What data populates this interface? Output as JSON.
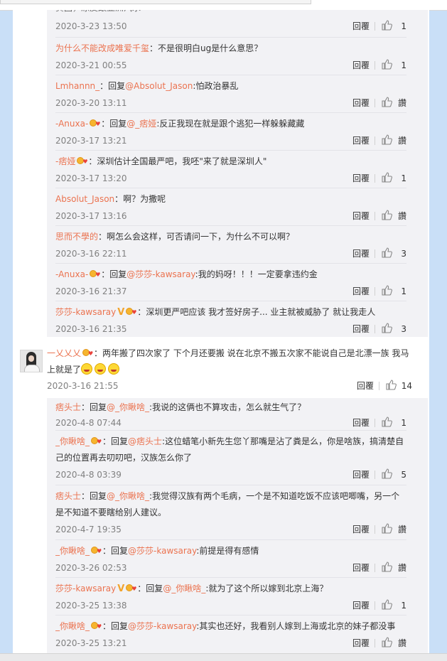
{
  "reply_label": "回覆",
  "like_icon": "thumbs-up-icon",
  "accent_color": "#eb7350",
  "thread1": [
    {
      "nick": "",
      "pre": "",
      "mention": "",
      "text": "",
      "time": "2020-3-23 13:50",
      "likes": "1",
      "clipped": "黄固，凉皮跟亚洲汽水"
    },
    {
      "nick": "为什么不能改成唯爱千玺",
      "pre": "：",
      "mention": "",
      "text": "不是很明白ug是什么意思？",
      "time": "2020-3-21 00:55",
      "likes": "1"
    },
    {
      "nick": "Lmhannn_",
      "pre": "：回复",
      "mention": "@Absolut_Jason",
      "text": ":怕政治暴乱",
      "time": "2020-3-20 13:11",
      "likes": "讚"
    },
    {
      "nick": "-Anuxa-",
      "badge": true,
      "pre": "：回复",
      "mention": "@_痞娅",
      "text": ":反正我现在就是跟个逃犯一样躲躲藏藏",
      "time": "2020-3-17 13:21",
      "likes": "讚"
    },
    {
      "nick": "-痞娅",
      "badge": true,
      "pre": "：",
      "mention": "",
      "text": "深圳估计全国最严吧，我呸\"来了就是深圳人\"",
      "time": "2020-3-17 13:20",
      "likes": "1"
    },
    {
      "nick": "Absolut_Jason",
      "pre": "：",
      "mention": "",
      "text": "啊？为撒呢",
      "time": "2020-3-17 13:16",
      "likes": "讚"
    },
    {
      "nick": "思而不學的",
      "pre": "：",
      "mention": "",
      "text": "啊怎么会这样，可否请问一下，为什么不可以啊？",
      "time": "2020-3-16 22:11",
      "likes": "3"
    },
    {
      "nick": "-Anuxa-",
      "badge": true,
      "pre": "：回复",
      "mention": "@莎莎-kawsaray",
      "text": ":我的妈呀！！！一定要拿违约金",
      "time": "2020-3-16 21:37",
      "likes": "1"
    },
    {
      "nick": "莎莎-kawsaray",
      "vip": true,
      "badge": true,
      "pre": "：",
      "mention": "",
      "text": "深圳更严吧应该 我才签好房子... 业主就被威胁了 就让我走人",
      "time": "2020-3-16 21:35",
      "likes": "3"
    }
  ],
  "main": {
    "nick": "一乂乂乂",
    "text": "：两年搬了四次家了 下个月还要搬 说在北京不搬五次家不能说自己是北漂一族 我马上就是了",
    "time": "2020-3-16 21:55",
    "likes": "14"
  },
  "thread2": [
    {
      "nick": "痞头士",
      "pre": "：回复",
      "mention": "@_你瞅啥_",
      "text": ":我说的这俩也不算攻击，怎么就生气了？",
      "time": "2020-4-8 07:44",
      "likes": "1"
    },
    {
      "nick": "_你瞅啥_",
      "badge": true,
      "pre": "：回复",
      "mention": "@痞头士",
      "text": ":这位蜡笔小新先生您丫那嘴是沾了粪是么，你是啥族，搞清楚自己的位置再去叨叨吧，汉族怎么你了",
      "time": "2020-4-8 03:39",
      "likes": "5"
    },
    {
      "nick": "痞头士",
      "pre": "：回复",
      "mention": "@_你瞅啥_",
      "text": ":我觉得汉族有两个毛病，一个是不知道吃饭不应该吧唧嘴，另一个是不知道不要瞎给别人建议。",
      "time": "2020-4-7 19:35",
      "likes": "讚"
    },
    {
      "nick": "_你瞅啥_",
      "badge": true,
      "pre": "：回复",
      "mention": "@莎莎-kawsaray",
      "text": ":前提是得有感情",
      "time": "2020-3-26 02:53",
      "likes": "讚"
    },
    {
      "nick": "莎莎-kawsaray",
      "vip": true,
      "badge": true,
      "pre": "：回复",
      "mention": "@_你瞅啥_",
      "text": ":就为了这个所以嫁到北京上海？",
      "time": "2020-3-25 13:38",
      "likes": "1"
    },
    {
      "nick": "_你瞅啥_",
      "badge": true,
      "pre": "：回复",
      "mention": "@莎莎-kawsaray",
      "text": ":其实也还好，我看别人嫁到上海或北京的妹子都没事",
      "time": "2020-3-25 13:21",
      "likes": "讚"
    }
  ]
}
